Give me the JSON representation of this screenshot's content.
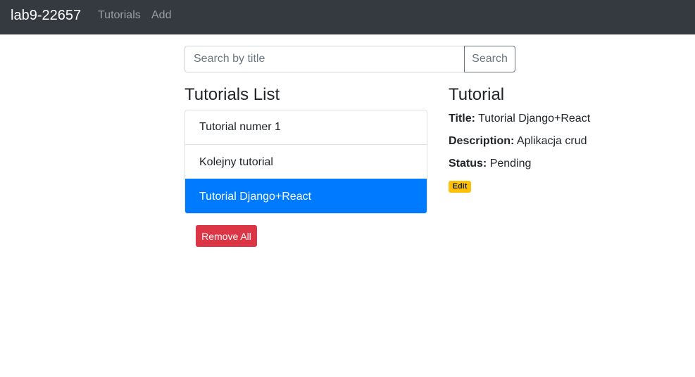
{
  "navbar": {
    "brand": "lab9-22657",
    "links": [
      {
        "label": "Tutorials"
      },
      {
        "label": "Add"
      }
    ]
  },
  "search": {
    "placeholder": "Search by title",
    "value": "",
    "button_label": "Search"
  },
  "tutorials_list": {
    "heading": "Tutorials List",
    "items": [
      {
        "title": "Tutorial numer 1",
        "active": false
      },
      {
        "title": "Kolejny tutorial",
        "active": false
      },
      {
        "title": "Tutorial Django+React",
        "active": true
      }
    ],
    "remove_all_label": "Remove All"
  },
  "tutorial_detail": {
    "heading": "Tutorial",
    "title_label": "Title:",
    "title_value": "Tutorial Django+React",
    "description_label": "Description:",
    "description_value": "Aplikacja crud",
    "status_label": "Status:",
    "status_value": "Pending",
    "edit_label": "Edit"
  },
  "colors": {
    "navbar_bg": "#343a40",
    "active_item": "#007bff",
    "danger": "#dc3545",
    "warning": "#ffc107"
  }
}
